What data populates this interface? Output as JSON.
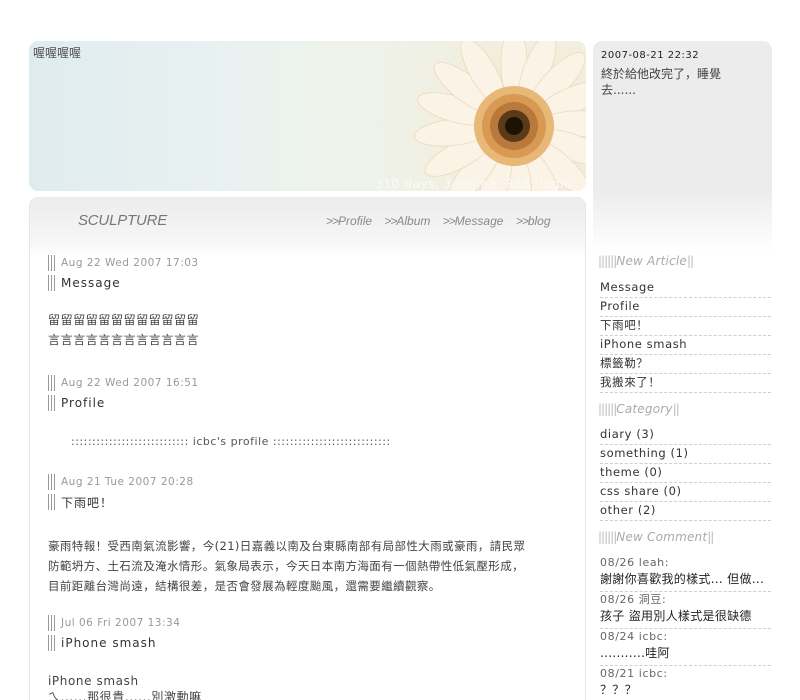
{
  "site": {
    "title": "喔喔喔喔",
    "stats": "310 days, 3 online, RSS, login"
  },
  "latest": {
    "timestamp": "2007-08-21 22:32",
    "message": "終於給他改完了，睡覺去......"
  },
  "main": {
    "brand": "SCULPTURE",
    "nav": [
      {
        "prefix": ">>",
        "label": "Profile"
      },
      {
        "prefix": ">>",
        "label": "Album"
      },
      {
        "prefix": ">>",
        "label": "Message"
      },
      {
        "prefix": ">>",
        "label": "blog"
      }
    ],
    "posts": [
      {
        "date": "Aug 22 Wed 2007 17:03",
        "title": "Message",
        "body": [
          "留留留留留留留留留留留留",
          "言言言言言言言言言言言言"
        ]
      },
      {
        "date": "Aug 22 Wed 2007 16:51",
        "title": "Profile",
        "body": [
          ":::::::::::::::::::::::::::: icbc's profile ::::::::::::::::::::::::::::"
        ]
      },
      {
        "date": "Aug 21 Tue 2007 20:28",
        "title": "下雨吧！",
        "body": [
          "豪雨特報！受西南氣流影響，今(21)日嘉義以南及台東縣南部有局部性大雨或豪雨，請民眾",
          "防範坍方、土石流及淹水情形。氣象局表示，今天日本南方海面有一個熱帶性低氣壓形成，",
          "目前距離台灣尚遠，結構很差，是否會發展為輕度颱風，還需要繼續觀察。"
        ]
      },
      {
        "date": "Jul 06 Fri 2007 13:34",
        "title": "iPhone smash",
        "body": [
          "iPhone smash",
          "ㄟ......那很貴......別激動嘛"
        ]
      }
    ]
  },
  "sidebar": {
    "new_article": {
      "heading": "New  Article",
      "items": [
        "Message",
        "Profile",
        "下雨吧！",
        "iPhone smash",
        "標籤勒？",
        "我搬來了！"
      ]
    },
    "category": {
      "heading": "Category",
      "items": [
        "diary (3)",
        "something (1)",
        "theme (0)",
        "css share (0)",
        "other (2)"
      ]
    },
    "new_comment": {
      "heading": "New Comment",
      "items": [
        {
          "who": "08/26 leah:",
          "text": "謝謝你喜歡我的樣式... 但做..."
        },
        {
          "who": "08/26 洞豆:",
          "text": "孩子 盜用別人樣式是很缺德"
        },
        {
          "who": "08/24 icbc:",
          "text": "...........哇阿"
        },
        {
          "who": "08/21 icbc:",
          "text": "？？？"
        }
      ]
    }
  }
}
